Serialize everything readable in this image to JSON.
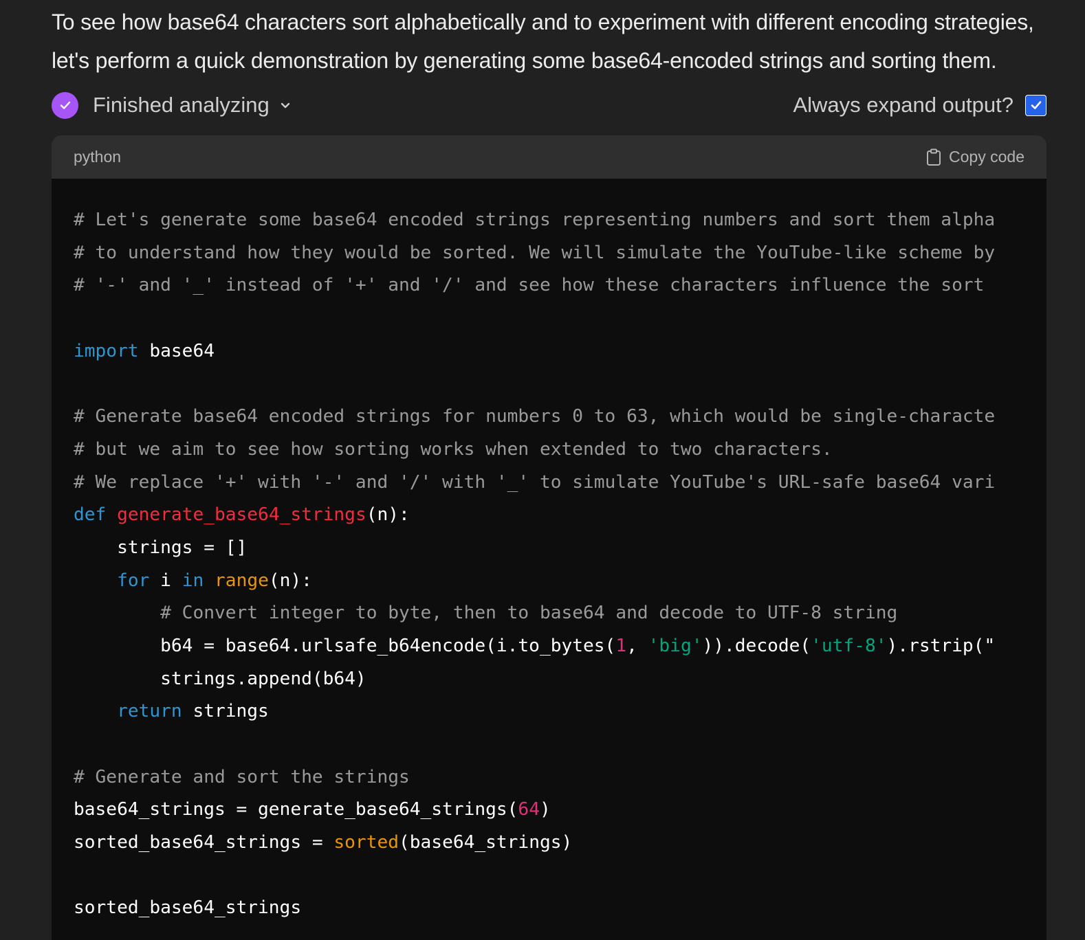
{
  "message": {
    "intro_line1": "To see how base64 characters sort alphabetically and to experiment with different encoding strategies,",
    "intro_line2": "let's perform a quick demonstration by generating some base64-encoded strings and sorting them."
  },
  "status": {
    "label": "Finished analyzing",
    "icon": "check-icon",
    "accent_color": "#a855f7"
  },
  "expand_output": {
    "label": "Always expand output?",
    "checked": true,
    "checkbox_color": "#2563eb"
  },
  "code_block": {
    "language": "python",
    "copy_label": "Copy code",
    "lines": [
      [
        [
          "com",
          "# Let's generate some base64 encoded strings representing numbers and sort them alpha"
        ]
      ],
      [
        [
          "com",
          "# to understand how they would be sorted. We will simulate the YouTube-like scheme by"
        ]
      ],
      [
        [
          "com",
          "# '-' and '_' instead of '+' and '/' and see how these characters influence the sort"
        ]
      ],
      [],
      [
        [
          "kw",
          "import"
        ],
        [
          "txt",
          " base64"
        ]
      ],
      [],
      [
        [
          "com",
          "# Generate base64 encoded strings for numbers 0 to 63, which would be single-characte"
        ]
      ],
      [
        [
          "com",
          "# but we aim to see how sorting works when extended to two characters."
        ]
      ],
      [
        [
          "com",
          "# We replace '+' with '-' and '/' with '_' to simulate YouTube's URL-safe base64 vari"
        ]
      ],
      [
        [
          "kw",
          "def"
        ],
        [
          "txt",
          " "
        ],
        [
          "fn",
          "generate_base64_strings"
        ],
        [
          "txt",
          "(n):"
        ]
      ],
      [
        [
          "txt",
          "    strings = []"
        ]
      ],
      [
        [
          "txt",
          "    "
        ],
        [
          "kw",
          "for"
        ],
        [
          "txt",
          " i "
        ],
        [
          "kw",
          "in"
        ],
        [
          "txt",
          " "
        ],
        [
          "bi",
          "range"
        ],
        [
          "txt",
          "(n):"
        ]
      ],
      [
        [
          "txt",
          "        "
        ],
        [
          "com",
          "# Convert integer to byte, then to base64 and decode to UTF-8 string"
        ]
      ],
      [
        [
          "txt",
          "        b64 = base64.urlsafe_b64encode(i.to_bytes("
        ],
        [
          "num",
          "1"
        ],
        [
          "txt",
          ", "
        ],
        [
          "str",
          "'big'"
        ],
        [
          "txt",
          ")).decode("
        ],
        [
          "str",
          "'utf-8'"
        ],
        [
          "txt",
          ").rstrip(\""
        ]
      ],
      [
        [
          "txt",
          "        strings.append(b64)"
        ]
      ],
      [
        [
          "txt",
          "    "
        ],
        [
          "kw",
          "return"
        ],
        [
          "txt",
          " strings"
        ]
      ],
      [],
      [
        [
          "com",
          "# Generate and sort the strings"
        ]
      ],
      [
        [
          "txt",
          "base64_strings = generate_base64_strings("
        ],
        [
          "num",
          "64"
        ],
        [
          "txt",
          ")"
        ]
      ],
      [
        [
          "txt",
          "sorted_base64_strings = "
        ],
        [
          "bi",
          "sorted"
        ],
        [
          "txt",
          "(base64_strings)"
        ]
      ],
      [],
      [
        [
          "txt",
          "sorted_base64_strings"
        ]
      ]
    ]
  }
}
